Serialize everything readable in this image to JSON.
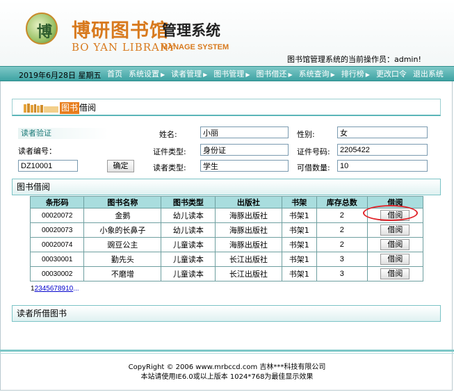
{
  "header": {
    "logo_cn_brand": "博研图书馆",
    "logo_cn_system": "管理系统",
    "logo_en_brand": "BO YAN LIBRARY",
    "logo_en_system": "MANAGE SYSTEM",
    "logo_badge_glyph": "博",
    "operator_text": "图书馆管理系统的当前操作员：admin!"
  },
  "navbar": {
    "date": "2019年6月28日 星期五",
    "items": [
      {
        "label": "首页",
        "has_arrow": false
      },
      {
        "label": "系统设置",
        "has_arrow": true
      },
      {
        "label": "读者管理",
        "has_arrow": true
      },
      {
        "label": "图书管理",
        "has_arrow": true
      },
      {
        "label": "图书借还",
        "has_arrow": true
      },
      {
        "label": "系统查询",
        "has_arrow": true
      },
      {
        "label": "排行榜",
        "has_arrow": true
      },
      {
        "label": "更改口令",
        "has_arrow": false
      },
      {
        "label": "退出系统",
        "has_arrow": false
      }
    ],
    "arrow_glyph": "▶"
  },
  "section": {
    "label_highlight": "图书",
    "label_rest": "借阅"
  },
  "reader_form": {
    "verify_title": "读者验证",
    "reader_id_label": "读者编号：",
    "reader_id_value": "DZ10001",
    "confirm_button": "确定",
    "name_label": "姓名:",
    "name_value": "小丽",
    "gender_label": "性别:",
    "gender_value": "女",
    "cert_type_label": "证件类型:",
    "cert_type_value": "身份证",
    "cert_no_label": "证件号码:",
    "cert_no_value": "2205422",
    "reader_type_label": "读者类型:",
    "reader_type_value": "学生",
    "borrow_limit_label": "可借数量:",
    "borrow_limit_value": "10"
  },
  "borrow_panel": {
    "title": "图书借阅",
    "columns": [
      "条形码",
      "图书名称",
      "图书类型",
      "出版社",
      "书架",
      "库存总数",
      "借阅"
    ],
    "rows": [
      {
        "barcode": "00020072",
        "name": "金鹅",
        "type": "幼儿读本",
        "publisher": "海豚出版社",
        "shelf": "书架1",
        "stock": "2",
        "action": "借阅"
      },
      {
        "barcode": "00020073",
        "name": "小象的长鼻子",
        "type": "幼儿读本",
        "publisher": "海豚出版社",
        "shelf": "书架1",
        "stock": "2",
        "action": "借阅"
      },
      {
        "barcode": "00020074",
        "name": "豌豆公主",
        "type": "儿童读本",
        "publisher": "海豚出版社",
        "shelf": "书架1",
        "stock": "2",
        "action": "借阅"
      },
      {
        "barcode": "00030001",
        "name": "勤先头",
        "type": "儿童读本",
        "publisher": "长江出版社",
        "shelf": "书架1",
        "stock": "3",
        "action": "借阅"
      },
      {
        "barcode": "00030002",
        "name": "不磨增",
        "type": "儿童读本",
        "publisher": "长江出版社",
        "shelf": "书架1",
        "stock": "3",
        "action": "借阅"
      }
    ],
    "pager": {
      "current": "1",
      "pages": [
        "2",
        "3",
        "4",
        "5",
        "6",
        "7",
        "8",
        "9",
        "10"
      ],
      "more": "..."
    }
  },
  "borrowed_panel": {
    "title": "读者所借图书"
  },
  "footer": {
    "copyright": "CopyRight © 2006 www.mrbccd.com 吉林***科技有限公司",
    "advice": "本站请使用IE6.0或以上版本 1024*768为最佳显示效果"
  },
  "colors": {
    "nav_bar": "#3ea3a3",
    "table_header": "#a9ddde",
    "brand_orange": "#d87a1e",
    "highlight_ring": "#e0242a"
  },
  "icons": [
    "library-logo-icon",
    "books-icon",
    "nav-arrow-icon"
  ]
}
